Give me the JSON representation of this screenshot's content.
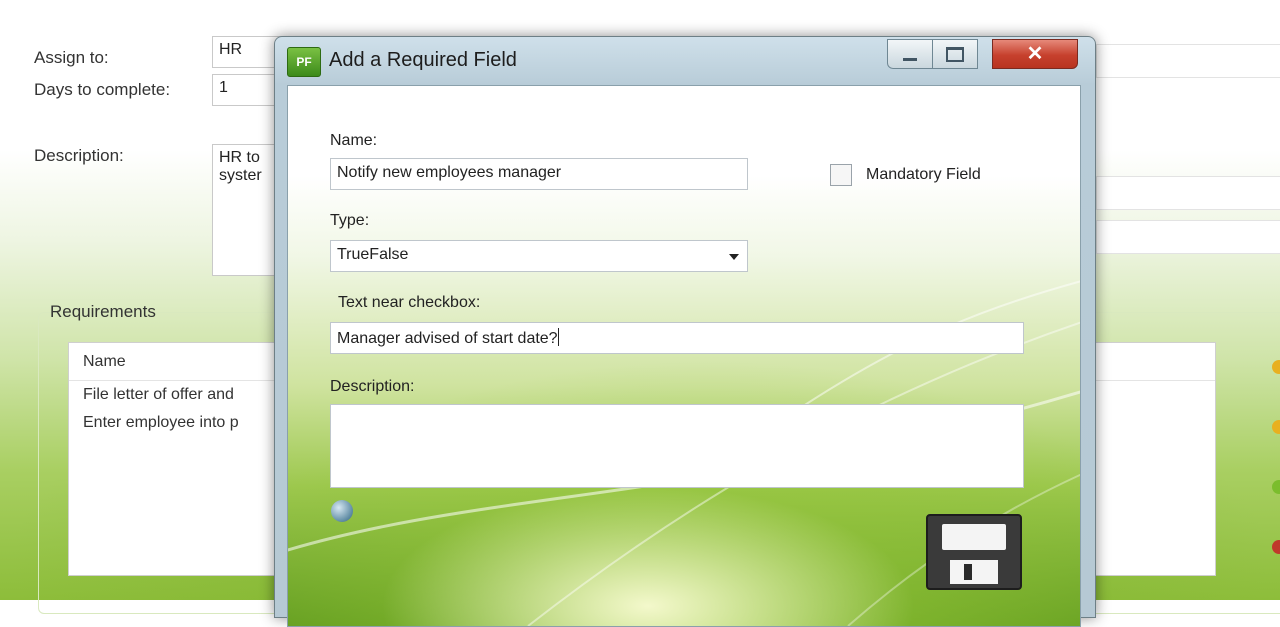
{
  "background": {
    "assign_to_label": "Assign to:",
    "assign_to_value": "HR",
    "days_label": "Days to complete:",
    "days_value": "1",
    "description_label": "Description:",
    "description_value_line1": "HR to",
    "description_value_line2": "syster",
    "requirements_group_label": "Requirements",
    "requirements_list": {
      "column_header": "Name",
      "rows": [
        "File letter of offer and",
        "Enter employee into p"
      ]
    },
    "status_dot_colors": [
      "#e8b020",
      "#e8b020",
      "#7bbd2d",
      "#c0392b"
    ]
  },
  "dialog": {
    "title": "Add a Required Field",
    "app_icon_text": "PF",
    "window_controls": {
      "minimize_icon": "minimize-icon",
      "maximize_icon": "maximize-icon",
      "close_icon": "close-icon",
      "close_glyph": "✕"
    },
    "name_label": "Name:",
    "name_value": "Notify new employees manager",
    "mandatory_label": "Mandatory Field",
    "mandatory_checked": false,
    "type_label": "Type:",
    "type_value": "TrueFalse",
    "checkbox_text_label": "Text near checkbox:",
    "checkbox_text_value": "Manager advised of start date?",
    "description_label": "Description:",
    "description_value": "",
    "help_icon": "help-globe-icon",
    "save_icon": "floppy-disk-icon"
  },
  "colors": {
    "accent_green": "#8dbd3a",
    "close_button_red": "#c6402d",
    "title_bar_blue": "#b8ccd8"
  }
}
